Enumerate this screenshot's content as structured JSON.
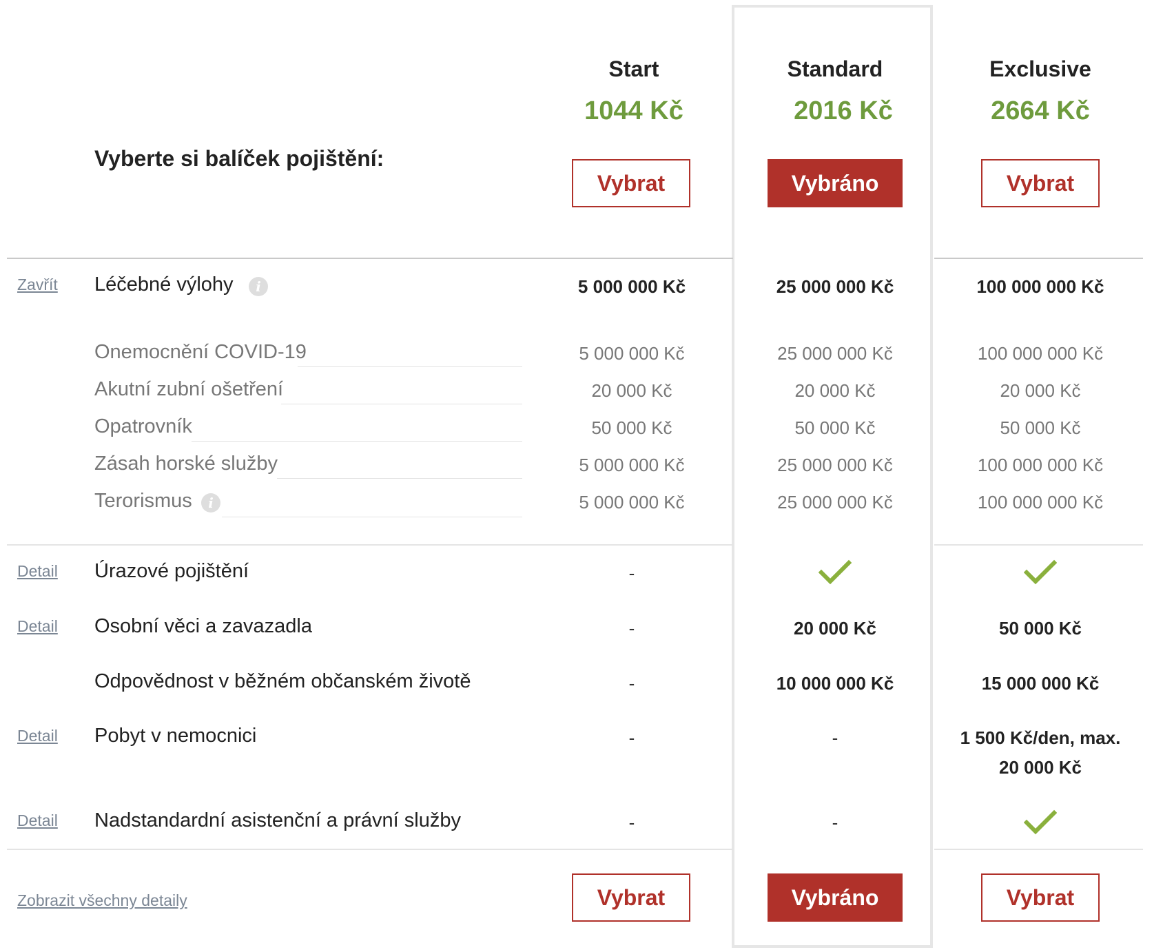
{
  "heading": "Vyberte si balíček pojištění:",
  "plans": [
    {
      "name": "Start",
      "price": "1044 Kč",
      "button": "Vybrat",
      "selected": false
    },
    {
      "name": "Standard",
      "price": "2016 Kč",
      "button": "Vybráno",
      "selected": true
    },
    {
      "name": "Exclusive",
      "price": "2664 Kč",
      "button": "Vybrat",
      "selected": false
    }
  ],
  "medical": {
    "link": "Zavřít",
    "label": "Léčebné výlohy",
    "values": [
      "5 000 000 Kč",
      "25 000 000 Kč",
      "100 000 000 Kč"
    ],
    "subrows": [
      {
        "label": "Onemocnění COVID-19",
        "values": [
          "5 000 000 Kč",
          "25 000 000 Kč",
          "100 000 000 Kč"
        ]
      },
      {
        "label": "Akutní zubní ošetření",
        "values": [
          "20 000 Kč",
          "20 000 Kč",
          "20 000 Kč"
        ]
      },
      {
        "label": "Opatrovník",
        "values": [
          "50 000 Kč",
          "50 000 Kč",
          "50 000 Kč"
        ]
      },
      {
        "label": "Zásah horské služby",
        "values": [
          "5 000 000 Kč",
          "25 000 000 Kč",
          "100 000 000 Kč"
        ]
      },
      {
        "label": "Terorismus",
        "values": [
          "5 000 000 Kč",
          "25 000 000 Kč",
          "100 000 000 Kč"
        ]
      }
    ]
  },
  "rows": [
    {
      "link": "Detail",
      "label": "Úrazové pojištění",
      "values": [
        "-",
        "check",
        "check"
      ]
    },
    {
      "link": "Detail",
      "label": "Osobní věci a zavazadla",
      "values": [
        "-",
        "20 000 Kč",
        "50 000 Kč"
      ]
    },
    {
      "link": "",
      "label": "Odpovědnost v běžném občanském životě",
      "values": [
        "-",
        "10 000 000 Kč",
        "15 000 000 Kč"
      ]
    },
    {
      "link": "Detail",
      "label": "Pobyt v nemocnici",
      "values": [
        "-",
        "-",
        "1 500 Kč/den, max."
      ],
      "value_line2": "20 000 Kč"
    },
    {
      "link": "Detail",
      "label": "Nadstandardní asistenční a právní služby",
      "values": [
        "-",
        "-",
        "check"
      ]
    }
  ],
  "footer": {
    "show_all": "Zobrazit všechny detaily"
  },
  "info_glyph": "i",
  "colors": {
    "accent": "#b0312a",
    "price": "#6e9b3d",
    "check": "#8ab03c"
  }
}
